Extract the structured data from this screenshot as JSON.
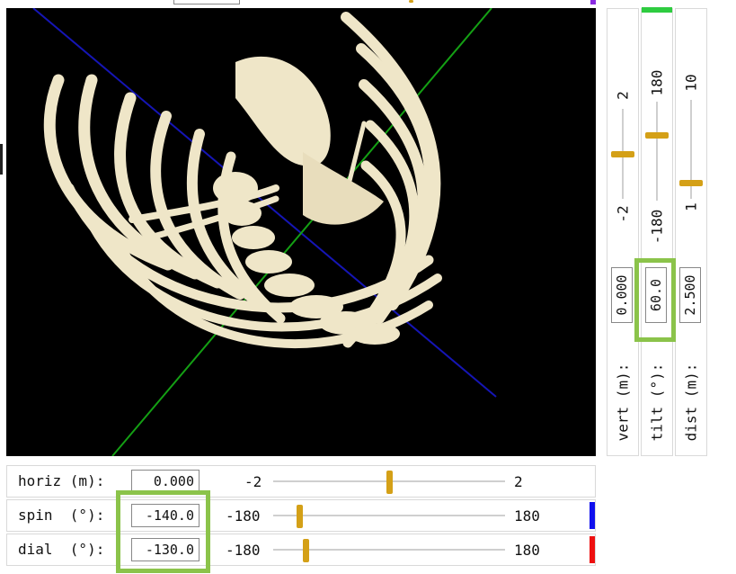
{
  "viewport": {
    "scene": "3d-ribcage-model",
    "background": "#000000",
    "axis_colors": {
      "blue": "#1515b5",
      "green": "#14a014"
    },
    "bone_color": "#efe6c8"
  },
  "vertical_controls": [
    {
      "name": "vert",
      "label": "vert  (m):",
      "value": "0.000",
      "min": "-2",
      "max": "2",
      "color": "",
      "highlighted": false
    },
    {
      "name": "tilt",
      "label": "tilt  (°):",
      "value": "60.0",
      "min": "-180",
      "max": "180",
      "color": "#2ecc40",
      "highlighted": true
    },
    {
      "name": "dist",
      "label": "dist  (m):",
      "value": "2.500",
      "min": "1",
      "max": "10",
      "color": "",
      "highlighted": false
    }
  ],
  "horizontal_controls": [
    {
      "name": "horiz",
      "label": "horiz (m):",
      "value": "0.000",
      "min": "-2",
      "max": "2",
      "level": 0.5,
      "color": "",
      "highlighted": false
    },
    {
      "name": "spin",
      "label": "spin  (°):",
      "value": "-140.0",
      "min": "-180",
      "max": "180",
      "level": 0.111,
      "color": "#1010ee",
      "highlighted": true
    },
    {
      "name": "dial",
      "label": "dial  (°):",
      "value": "-130.0",
      "min": "-180",
      "max": "180",
      "level": 0.139,
      "color": "#ee1010",
      "highlighted": true
    }
  ],
  "levels": {
    "vert": 0.5,
    "tilt": 0.667,
    "dist": 0.167
  },
  "highlight_color": "#8bc34a"
}
